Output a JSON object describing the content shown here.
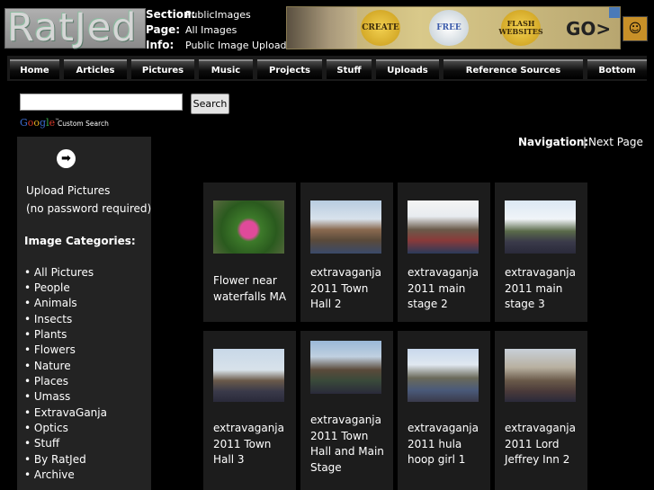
{
  "header": {
    "logo_text": "RatJed",
    "section_label": "Section:",
    "section_value": "PublicImages",
    "page_label": "Page:",
    "page_value": "All Images",
    "info_label": "Info:",
    "info_value": "Public Image Uploads",
    "ad": {
      "btn1": "CREATE",
      "btn2": "FREE",
      "btn3": "FLASH WEBSITES",
      "go": "GO>"
    }
  },
  "nav": [
    "Home",
    "Articles",
    "Pictures",
    "Music",
    "Projects",
    "Stuff",
    "Uploads",
    "Reference Sources",
    "Bottom"
  ],
  "search": {
    "value": "",
    "button": "Search",
    "google": [
      "G",
      "o",
      "o",
      "g",
      "l",
      "e"
    ],
    "custom": "Custom Search",
    "tm": "™"
  },
  "sidebar": {
    "upload_line1": "Upload Pictures",
    "upload_line2": "(no password required)",
    "categories_title": "Image Categories:",
    "categories": [
      "• All Pictures",
      "• People",
      "• Animals",
      "• Insects",
      "• Plants",
      "• Flowers",
      "• Nature",
      "• Places",
      "• Umass",
      "• ExtravaGanja",
      "• Optics",
      "• Stuff",
      "• By RatJed",
      "• Archive"
    ]
  },
  "navigation": {
    "label": "Navigation:",
    "sep": "|",
    "next": "Next Page"
  },
  "gallery": [
    {
      "lines": [
        "Flower near",
        "waterfalls MA"
      ]
    },
    {
      "lines": [
        "extravaganja",
        "2011 Town",
        "Hall 2"
      ]
    },
    {
      "lines": [
        "extravaganja",
        "2011 main",
        "stage 2"
      ]
    },
    {
      "lines": [
        "extravaganja",
        "2011 main",
        "stage 3"
      ]
    },
    {
      "lines": [
        "extravaganja",
        "2011 Town",
        "Hall 3"
      ]
    },
    {
      "lines": [
        "extravaganja",
        "2011 Town",
        "Hall and Main",
        "Stage"
      ]
    },
    {
      "lines": [
        "extravaganja",
        "2011 hula",
        "hoop girl 1"
      ]
    },
    {
      "lines": [
        "extravaganja",
        "2011 Lord",
        "Jeffrey Inn 2"
      ]
    }
  ]
}
